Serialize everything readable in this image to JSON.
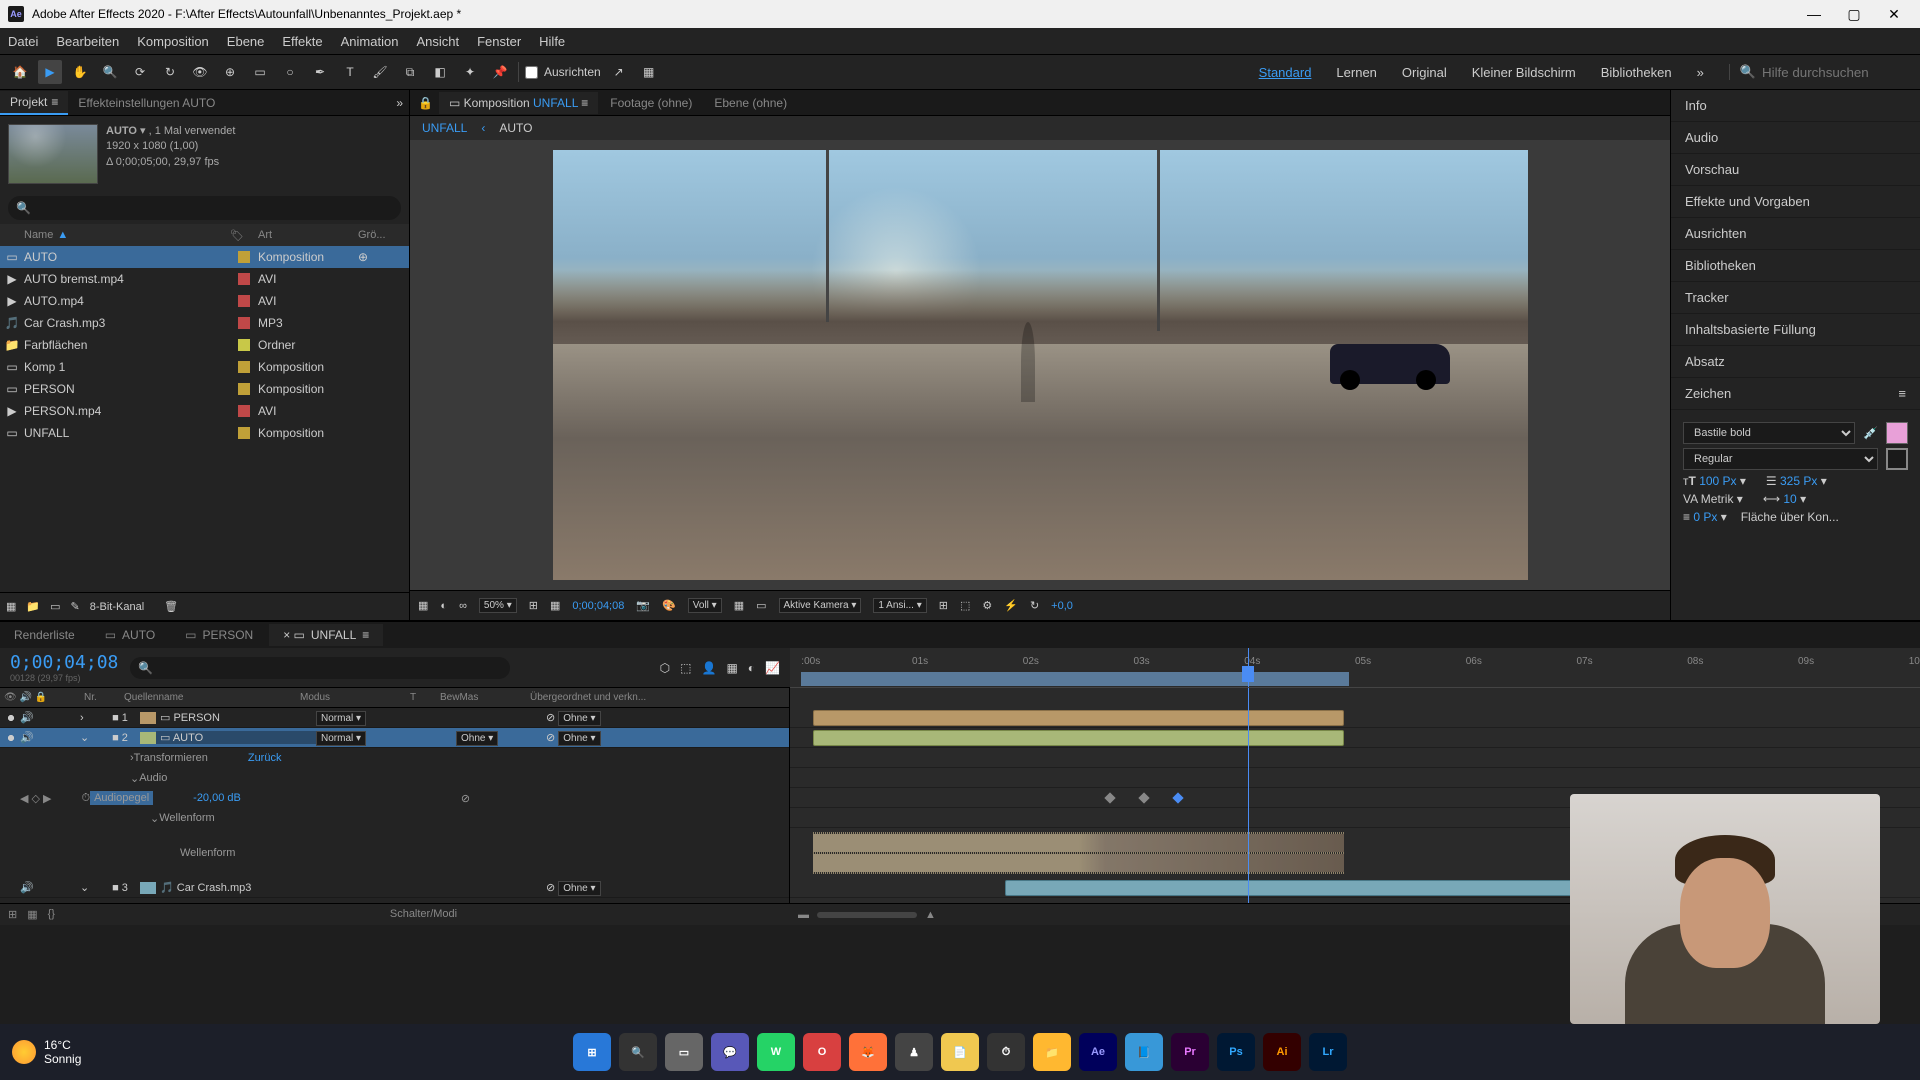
{
  "titlebar": {
    "app": "Adobe After Effects 2020",
    "path": "F:\\After Effects\\Autounfall\\Unbenanntes_Projekt.aep *"
  },
  "menu": [
    "Datei",
    "Bearbeiten",
    "Komposition",
    "Ebene",
    "Effekte",
    "Animation",
    "Ansicht",
    "Fenster",
    "Hilfe"
  ],
  "toolbar": {
    "snap_label": "Ausrichten",
    "workspaces": [
      "Standard",
      "Lernen",
      "Original",
      "Kleiner Bildschirm",
      "Bibliotheken"
    ],
    "active_workspace": 0,
    "search_placeholder": "Hilfe durchsuchen"
  },
  "project": {
    "tab_project": "Projekt",
    "tab_effectcontrols": "Effekteinstellungen AUTO",
    "thumb_name": "AUTO",
    "thumb_used": ", 1 Mal verwendet",
    "thumb_dims": "1920 x 1080 (1,00)",
    "thumb_dur": "Δ 0;00;05;00, 29,97 fps",
    "search_placeholder": "",
    "headers": {
      "name": "Name",
      "type": "Art",
      "size": "Grö..."
    },
    "items": [
      {
        "name": "AUTO",
        "type": "Komposition",
        "color": "#c0a038",
        "sel": true,
        "icon": "comp",
        "ext": true
      },
      {
        "name": "AUTO bremst.mp4",
        "type": "AVI",
        "color": "#c04848",
        "icon": "vid"
      },
      {
        "name": "AUTO.mp4",
        "type": "AVI",
        "color": "#c04848",
        "icon": "vid"
      },
      {
        "name": "Car Crash.mp3",
        "type": "MP3",
        "color": "#c04848",
        "icon": "aud"
      },
      {
        "name": "Farbflächen",
        "type": "Ordner",
        "color": "#c8c848",
        "icon": "fold"
      },
      {
        "name": "Komp 1",
        "type": "Komposition",
        "color": "#c0a038",
        "icon": "comp"
      },
      {
        "name": "PERSON",
        "type": "Komposition",
        "color": "#c0a038",
        "icon": "comp"
      },
      {
        "name": "PERSON.mp4",
        "type": "AVI",
        "color": "#c04848",
        "icon": "vid"
      },
      {
        "name": "UNFALL",
        "type": "Komposition",
        "color": "#c0a038",
        "icon": "comp"
      }
    ],
    "footer_depth": "8-Bit-Kanal"
  },
  "comp": {
    "tabs": [
      {
        "pre": "Komposition",
        "name": "UNFALL",
        "active": true
      },
      {
        "pre": "Footage",
        "name": "(ohne)"
      },
      {
        "pre": "Ebene",
        "name": "(ohne)"
      }
    ],
    "breadcrumb": [
      "UNFALL",
      "AUTO"
    ],
    "controls": {
      "zoom": "50%",
      "timecode": "0;00;04;08",
      "res": "Voll",
      "view": "Aktive Kamera",
      "views": "1 Ansi...",
      "exposure": "+0,0"
    }
  },
  "right_panels": [
    "Info",
    "Audio",
    "Vorschau",
    "Effekte und Vorgaben",
    "Ausrichten",
    "Bibliotheken",
    "Tracker",
    "Inhaltsbasierte Füllung",
    "Absatz",
    "Zeichen"
  ],
  "character": {
    "font": "Bastile bold",
    "style": "Regular",
    "size_label": "T",
    "size": "100 Px",
    "leading": "325 Px",
    "kerning": "Metrik",
    "tracking": "10",
    "stroke": "0 Px",
    "fill_label": "Fläche über Kon..."
  },
  "timeline": {
    "tabs": [
      {
        "label": "Renderliste"
      },
      {
        "label": "AUTO",
        "icon": true
      },
      {
        "label": "PERSON",
        "icon": true
      },
      {
        "label": "UNFALL",
        "icon": true,
        "active": true
      }
    ],
    "timecode": "0;00;04;08",
    "subtime": "00128 (29,97 fps)",
    "ruler": [
      ":00s",
      "01s",
      "02s",
      "03s",
      "04s",
      "05s",
      "06s",
      "07s",
      "08s",
      "09s",
      "10"
    ],
    "cols": {
      "nr": "Nr.",
      "source": "Quellenname",
      "mode": "Modus",
      "trk": "BewMas",
      "parent": "Übergeordnet und verkn..."
    },
    "layers": [
      {
        "idx": "1",
        "name": "PERSON",
        "mode": "Normal",
        "color": "#b89868",
        "parent": "Ohne"
      },
      {
        "idx": "2",
        "name": "AUTO",
        "mode": "Normal",
        "trk": "Ohne",
        "color": "#a8b878",
        "parent": "Ohne",
        "sel": true
      },
      {
        "idx": "3",
        "name": "Car Crash.mp3",
        "color": "#78a8b8",
        "parent": "Ohne"
      }
    ],
    "sub": {
      "transform": "Transformieren",
      "transform_reset": "Zurück",
      "audio": "Audio",
      "audiolevels": "Audiopegel",
      "audiolevels_val": "-20,00 dB",
      "waveform": "Wellenform",
      "waveform2": "Wellenform",
      "waveform3": "Wellenform"
    },
    "footer": "Schalter/Modi",
    "playhead_pct": 40.5,
    "workarea_end_pct": 48.5
  },
  "taskbar": {
    "temp": "16°C",
    "cond": "Sonnig",
    "apps": [
      {
        "bg": "#2878d8",
        "txt": "⊞"
      },
      {
        "bg": "#333",
        "txt": "🔍"
      },
      {
        "bg": "#666",
        "txt": "▭"
      },
      {
        "bg": "#5858b8",
        "txt": "💬"
      },
      {
        "bg": "#25d366",
        "txt": "W"
      },
      {
        "bg": "#d84040",
        "txt": "O"
      },
      {
        "bg": "#ff7139",
        "txt": "🦊"
      },
      {
        "bg": "#444",
        "txt": "♟"
      },
      {
        "bg": "#f0c850",
        "txt": "📄"
      },
      {
        "bg": "#333",
        "txt": "⏱"
      },
      {
        "bg": "#ffb830",
        "txt": "📁"
      },
      {
        "bg": "#00005b",
        "txt": "Ae",
        "fg": "#9999ff"
      },
      {
        "bg": "#3898d8",
        "txt": "📘"
      },
      {
        "bg": "#2a0033",
        "txt": "Pr",
        "fg": "#e878ff"
      },
      {
        "bg": "#001833",
        "txt": "Ps",
        "fg": "#31a8ff"
      },
      {
        "bg": "#330000",
        "txt": "Ai",
        "fg": "#ff9a00"
      },
      {
        "bg": "#001833",
        "txt": "Lr",
        "fg": "#31a8ff"
      }
    ]
  }
}
